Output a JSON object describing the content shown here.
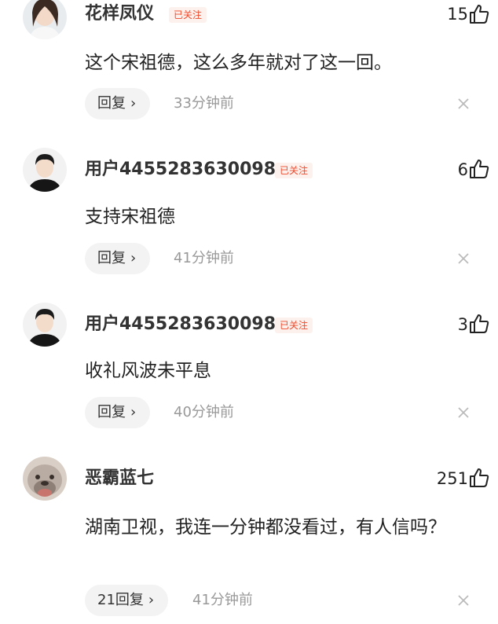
{
  "comments": [
    {
      "username": "花样凤仪",
      "follow_label": "已关注",
      "likes": "15",
      "text": "这个宋祖德，这么多年就对了这一回。",
      "reply_label": "回复",
      "time": "33分钟前",
      "avatar_icon": "woman-avatar-icon"
    },
    {
      "username": "用户4455283630098",
      "follow_label": "已关注",
      "likes": "6",
      "text": "支持宋祖德",
      "reply_label": "回复",
      "time": "41分钟前",
      "avatar_icon": "man-avatar-icon"
    },
    {
      "username": "用户4455283630098",
      "follow_label": "已关注",
      "likes": "3",
      "text": "收礼风波未平息",
      "reply_label": "回复",
      "time": "40分钟前",
      "avatar_icon": "man-avatar-icon"
    },
    {
      "username": "恶霸蓝七",
      "follow_label": "",
      "likes": "251",
      "text": "湖南卫视，我连一分钟都没看过，有人信吗？",
      "reply_label": "21回复",
      "time": "41分钟前",
      "avatar_icon": "dog-avatar-icon"
    }
  ],
  "colors": {
    "follow": "#f04a2c",
    "time": "#999999",
    "reply_bg": "#f3f3f3"
  }
}
